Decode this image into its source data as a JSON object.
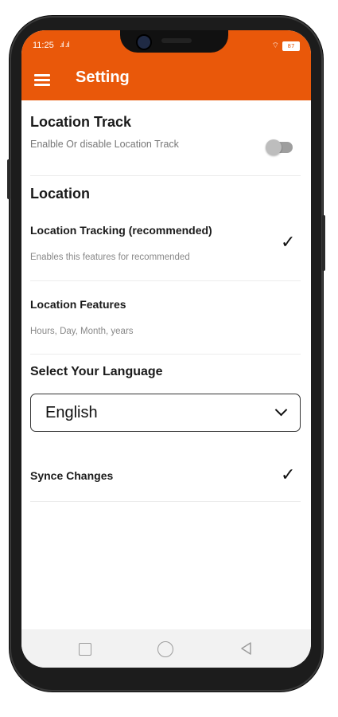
{
  "status_bar": {
    "time": "11:25",
    "signal": ".ıl .ıl",
    "battery": "87"
  },
  "app_bar": {
    "title": "Setting",
    "menu_icon": "hamburger-menu-icon",
    "color": "#e9580a"
  },
  "sections": {
    "location_track": {
      "title": "Location Track",
      "description": "Enalble Or disable Location Track",
      "toggle_enabled": false
    },
    "location": {
      "title": "Location",
      "items": [
        {
          "title": "Location Tracking (recommended)",
          "subtitle": "Enables this features for recommended",
          "checked": true
        },
        {
          "title": "Location Features",
          "subtitle": "Hours, Day, Month, years"
        }
      ]
    },
    "language": {
      "title": "Select Your Language",
      "selected": "English"
    },
    "sync": {
      "title": "Synce Changes",
      "checked": true
    }
  },
  "nav_bar": {
    "icons": [
      "recent-apps-icon",
      "home-icon",
      "back-icon"
    ]
  }
}
